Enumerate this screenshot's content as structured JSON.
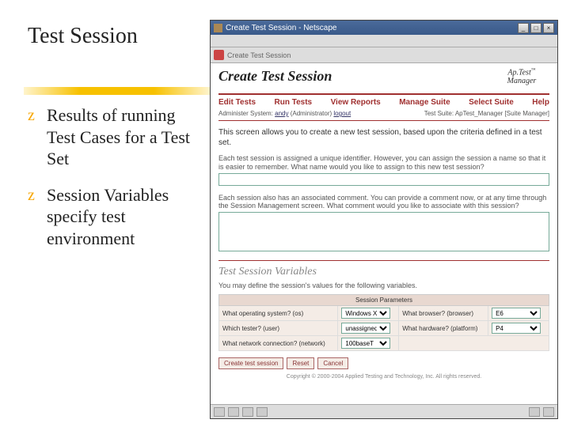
{
  "slide": {
    "title": "Test Session",
    "bullets": [
      "Results of running Test Cases for a Test Set",
      "Session Variables specify test environment"
    ]
  },
  "window": {
    "title": "Create Test Session - Netscape",
    "btn_min": "_",
    "btn_max": "□",
    "btn_close": "×",
    "toolbar_label": "Create Test Session"
  },
  "page": {
    "heading": "Create Test Session",
    "logo_top": "Ap.Test",
    "logo_bottom": "Manager",
    "nav": [
      "Edit Tests",
      "Run Tests",
      "View Reports",
      "Manage Suite",
      "Select Suite",
      "Help"
    ],
    "subleft_prefix": "Administer System: ",
    "subleft_link": "andy",
    "subleft_role": " (Administrator) ",
    "subleft_logout": "logout",
    "subright": "Test Suite: ApTest_Manager [Suite Manager]",
    "intro": "This screen allows you to create a new test session, based upon the criteria defined in a test set.",
    "para1": "Each test session is assigned a unique identifier. However, you can assign the session a name so that it is easier to remember. What name would you like to assign to this new test session?",
    "para2": "Each session also has an associated comment. You can provide a comment now, or at any time through the Session Management screen. What comment would you like to associate with this session?",
    "section": "Test Session Variables",
    "section_sub": "You may define the session's values for the following variables.",
    "table_header": "Session Parameters",
    "rows": [
      {
        "l": "What operating system? (os)",
        "lv": "Windows XP",
        "r": "What browser? (browser)",
        "rv": "E6"
      },
      {
        "l": "Which tester? (user)",
        "lv": "unassigned",
        "r": "What hardware? (platform)",
        "rv": "P4"
      },
      {
        "l": "What network connection? (network)",
        "lv": "100baseT",
        "r": "",
        "rv": ""
      }
    ],
    "btn_create": "Create test session",
    "btn_reset": "Reset",
    "btn_cancel": "Cancel",
    "copyright": "Copyright © 2000-2004 Applied Testing and Technology, Inc. All rights reserved."
  }
}
